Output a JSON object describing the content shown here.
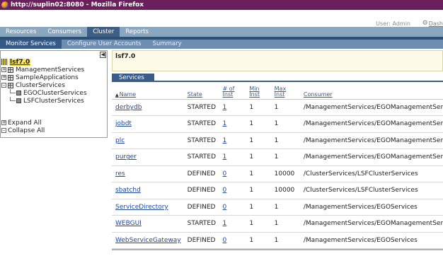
{
  "browser": {
    "title": "http://suplin02:8080 - Mozilla Firefox"
  },
  "userbar": {
    "user": "User: Admin",
    "dash_label": "Dash"
  },
  "main_tabs": [
    {
      "label": "Resources",
      "active": false
    },
    {
      "label": "Consumers",
      "active": false
    },
    {
      "label": "Cluster",
      "active": true
    },
    {
      "label": "Reports",
      "active": false
    }
  ],
  "sub_tabs": [
    {
      "label": "Monitor Services",
      "active": true
    },
    {
      "label": "Configure User Accounts",
      "active": false
    },
    {
      "label": "Summary",
      "active": false
    }
  ],
  "tree": {
    "root": "lsf7.0",
    "nodes": [
      {
        "label": "ManagementServices",
        "expanded": false
      },
      {
        "label": "SampleApplications",
        "expanded": false
      },
      {
        "label": "ClusterServices",
        "expanded": true
      }
    ],
    "children": [
      "EGOClusterServices",
      "LSFClusterServices"
    ],
    "expand_all": "Expand All",
    "collapse_all": "Collapse All"
  },
  "content": {
    "title": "lsf7.0",
    "section_tab": "Services"
  },
  "table": {
    "headers": {
      "name": "Name",
      "state": "State",
      "inst": "# of Inst",
      "min": "Min Inst",
      "max": "Max Inst",
      "consumer": "Consumer"
    },
    "rows": [
      {
        "name": "derbydb",
        "state": "STARTED",
        "inst": "1",
        "min": "1",
        "max": "1",
        "consumer": "/ManagementServices/EGOManagementServi"
      },
      {
        "name": "jobdt",
        "state": "STARTED",
        "inst": "1",
        "min": "1",
        "max": "1",
        "consumer": "/ManagementServices/EGOManagementServi"
      },
      {
        "name": "plc",
        "state": "STARTED",
        "inst": "1",
        "min": "1",
        "max": "1",
        "consumer": "/ManagementServices/EGOManagementServi"
      },
      {
        "name": "purger",
        "state": "STARTED",
        "inst": "1",
        "min": "1",
        "max": "1",
        "consumer": "/ManagementServices/EGOManagementServi"
      },
      {
        "name": "res",
        "state": "DEFINED",
        "inst": "0",
        "min": "1",
        "max": "10000",
        "consumer": "/ClusterServices/LSFClusterServices"
      },
      {
        "name": "sbatchd",
        "state": "DEFINED",
        "inst": "0",
        "min": "1",
        "max": "10000",
        "consumer": "/ClusterServices/LSFClusterServices"
      },
      {
        "name": "ServiceDirectory",
        "state": "DEFINED",
        "inst": "0",
        "min": "1",
        "max": "1",
        "consumer": "/ManagementServices/EGOServices"
      },
      {
        "name": "WEBGUI",
        "state": "STARTED",
        "inst": "1",
        "min": "1",
        "max": "1",
        "consumer": "/ManagementServices/EGOManagementServi"
      },
      {
        "name": "WebServiceGateway",
        "state": "DEFINED",
        "inst": "0",
        "min": "1",
        "max": "1",
        "consumer": "/ManagementServices/EGOServices"
      }
    ]
  }
}
